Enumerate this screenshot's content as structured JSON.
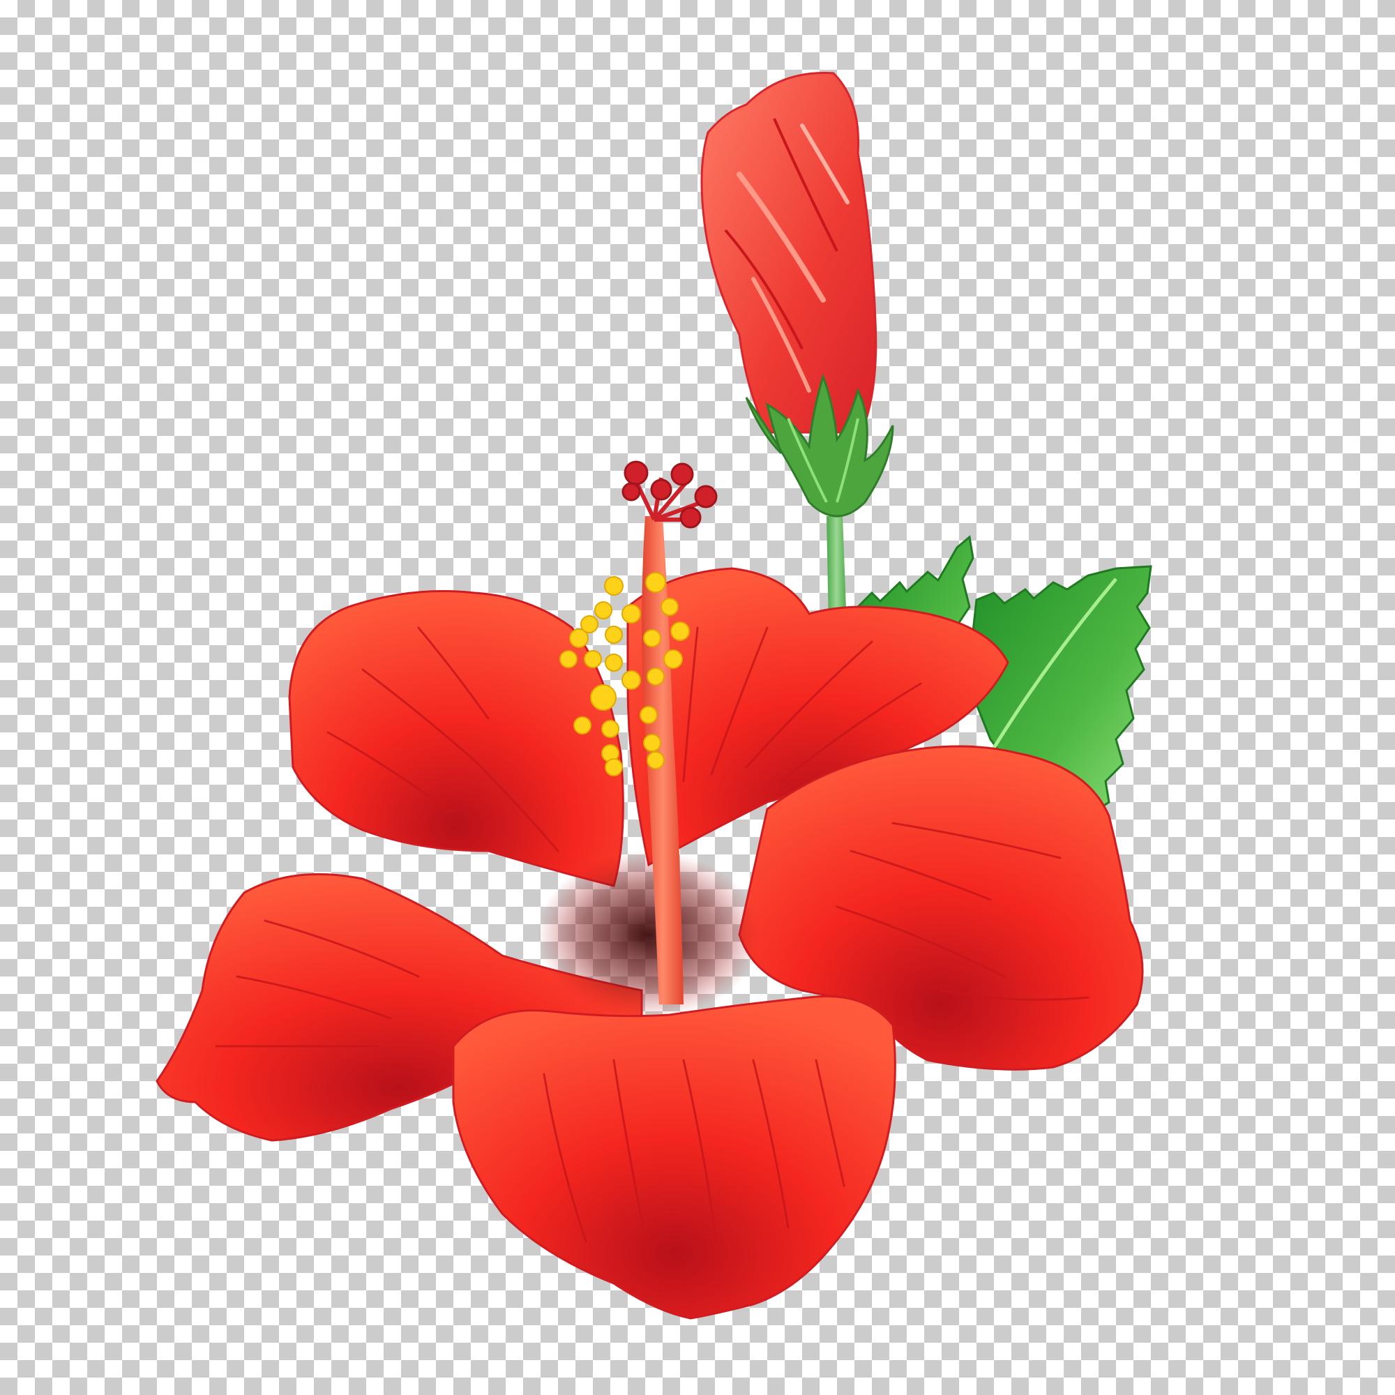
{
  "image": {
    "subject": "hibiscus-flower-illustration",
    "background": "transparency-checkerboard"
  },
  "colors": {
    "petal_light": "#ff5a3c",
    "petal_main": "#f4261f",
    "petal_dark": "#c4121a",
    "petal_vein": "#c8161a",
    "center_dark": "#5a1010",
    "bud_main": "#ee3a33",
    "bud_highlight": "#ff8a78",
    "stem_green": "#7bc47a",
    "leaf_light": "#72d05c",
    "leaf_dark": "#1f8f28",
    "sepal_green": "#4ca53d",
    "pollen_yellow": "#ffd21a",
    "stigma_red": "#d0202a",
    "checker_light": "#ffffff",
    "checker_dark": "#cccccc"
  }
}
